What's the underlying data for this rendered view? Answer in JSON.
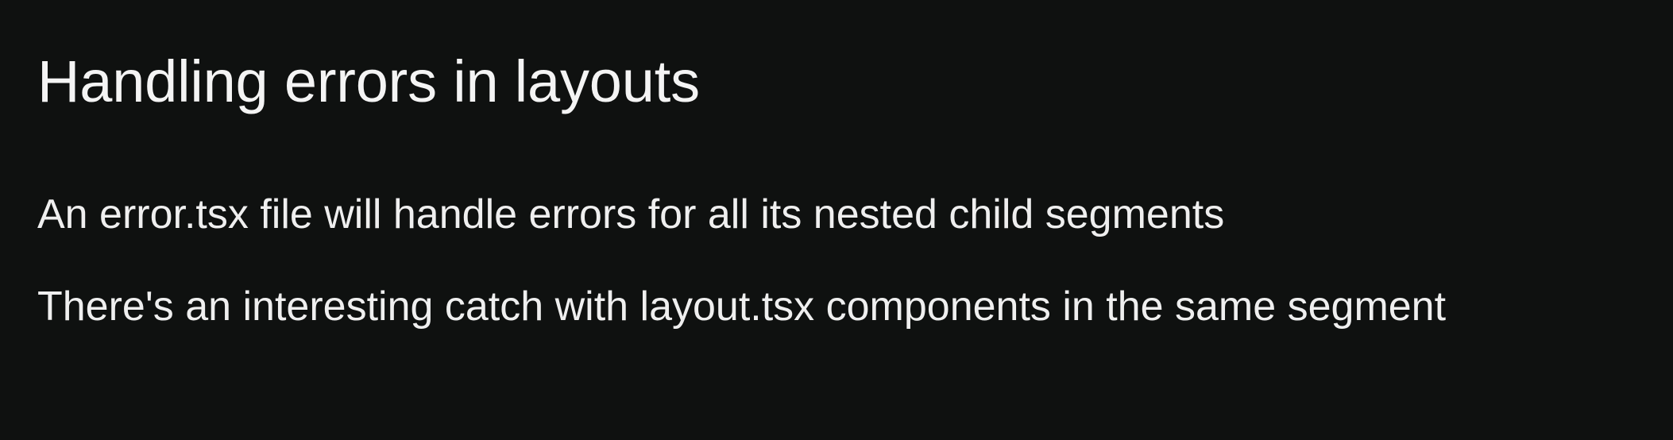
{
  "slide": {
    "title": "Handling errors in layouts",
    "bullets": [
      "An error.tsx file will handle errors for all its nested child segments",
      "There's an interesting catch with layout.tsx components in the same segment"
    ]
  },
  "colors": {
    "background": "#0f1110",
    "text": "#f2f2f2"
  }
}
